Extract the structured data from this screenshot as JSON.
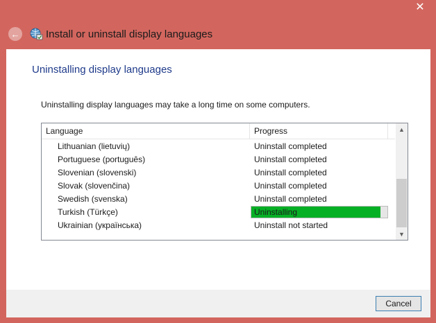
{
  "window": {
    "title": "Install or uninstall display languages",
    "close_label": "✕",
    "back_label": "←"
  },
  "main": {
    "heading": "Uninstalling display languages",
    "description": "Uninstalling display languages may take a long time on some computers.",
    "table": {
      "columns": [
        "Language",
        "Progress"
      ],
      "rows": [
        {
          "language": "Lithuanian (lietuvių)",
          "progress": "Uninstall completed"
        },
        {
          "language": "Portuguese (português)",
          "progress": "Uninstall completed"
        },
        {
          "language": "Slovenian (slovenski)",
          "progress": "Uninstall completed"
        },
        {
          "language": "Slovak (slovenčina)",
          "progress": "Uninstall completed"
        },
        {
          "language": "Swedish (svenska)",
          "progress": "Uninstall completed"
        },
        {
          "language": "Turkish (Türkçe)",
          "progress": "Uninstalling",
          "progress_fraction": 0.95
        },
        {
          "language": "Ukrainian (українська)",
          "progress": "Uninstall not started"
        }
      ]
    }
  },
  "footer": {
    "cancel_label": "Cancel"
  },
  "colors": {
    "frame": "#d2665e",
    "heading": "#1e3a8a",
    "progress_fill": "#06b025"
  },
  "icons": {
    "back": "back-arrow-icon",
    "app": "globe-language-icon",
    "close": "close-icon"
  }
}
